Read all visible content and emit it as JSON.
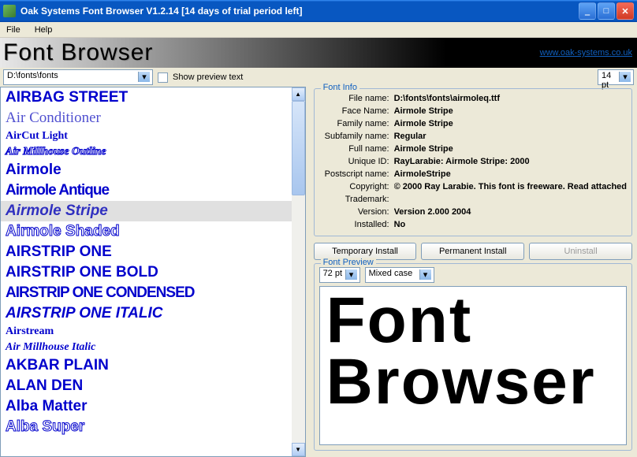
{
  "window": {
    "title": "Oak Systems Font Browser V1.2.14 [14 days of trial period left]"
  },
  "menu": {
    "file": "File",
    "help": "Help"
  },
  "banner": {
    "title": "Font Browser",
    "link": "www.oak-systems.co.uk"
  },
  "toolbar": {
    "path": "D:\\fonts\\fonts",
    "show_preview_label": "Show preview text",
    "size": "14 pt"
  },
  "fonts": [
    {
      "name": "AIRBAG STREET",
      "cls": ""
    },
    {
      "name": "Air Conditioner",
      "cls": "thin"
    },
    {
      "name": "AirCut Light",
      "cls": "small"
    },
    {
      "name": "Air Millhouse Outline",
      "cls": "outline ital small"
    },
    {
      "name": "Airmole",
      "cls": ""
    },
    {
      "name": "Airmole Antique",
      "cls": "cond"
    },
    {
      "name": "Airmole Stripe",
      "cls": "sel ital"
    },
    {
      "name": "Airmole Shaded",
      "cls": "outline"
    },
    {
      "name": "AIRSTRIP ONE",
      "cls": ""
    },
    {
      "name": "AIRSTRIP ONE BOLD",
      "cls": ""
    },
    {
      "name": "AIRSTRIP ONE CONDENSED",
      "cls": "cond"
    },
    {
      "name": "AIRSTRIP ONE ITALIC",
      "cls": "ital"
    },
    {
      "name": "Airstream",
      "cls": "small"
    },
    {
      "name": "Air Millhouse Italic",
      "cls": "ital small"
    },
    {
      "name": "AKBAR PLAIN",
      "cls": ""
    },
    {
      "name": "ALAN DEN",
      "cls": ""
    },
    {
      "name": "Alba Matter",
      "cls": ""
    },
    {
      "name": "Alba Super",
      "cls": "outline"
    }
  ],
  "info": {
    "group_label": "Font Info",
    "file_name_l": "File name:",
    "file_name": "D:\\fonts\\fonts\\airmoleq.ttf",
    "face_name_l": "Face Name:",
    "face_name": "Airmole Stripe",
    "family_name_l": "Family name:",
    "family_name": "Airmole Stripe",
    "subfamily_l": "Subfamily name:",
    "subfamily": "Regular",
    "full_name_l": "Full name:",
    "full_name": "Airmole Stripe",
    "unique_id_l": "Unique ID:",
    "unique_id": "RayLarabie: Airmole Stripe: 2000",
    "postscript_l": "Postscript name:",
    "postscript": "AirmoleStripe",
    "copyright_l": "Copyright:",
    "copyright": "© 2000 Ray Larabie. This font is freeware. Read attached",
    "trademark_l": "Trademark:",
    "trademark": "",
    "version_l": "Version:",
    "version": "Version 2.000 2004",
    "installed_l": "Installed:",
    "installed": "No"
  },
  "buttons": {
    "temp_install": "Temporary Install",
    "perm_install": "Permanent Install",
    "uninstall": "Uninstall"
  },
  "preview": {
    "group_label": "Font Preview",
    "size": "72 pt",
    "case": "Mixed case",
    "line1": "Font",
    "line2": "Browser"
  }
}
